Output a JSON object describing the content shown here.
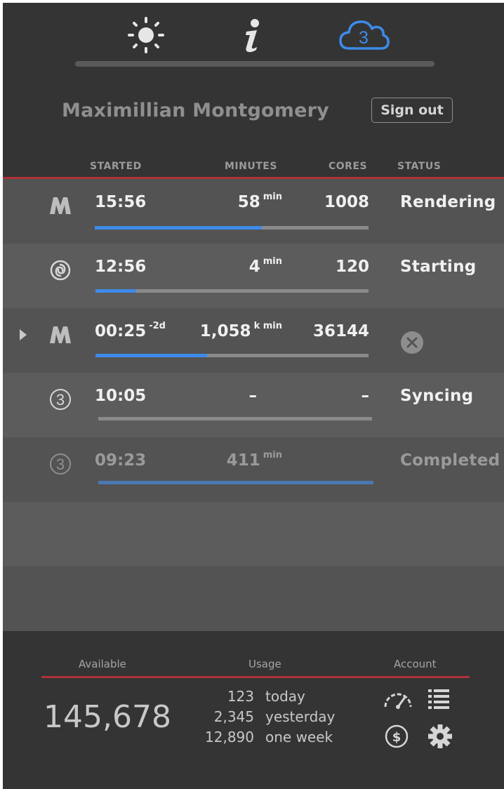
{
  "tabs": [
    {
      "name": "weather",
      "icon": "sun-icon",
      "active": false
    },
    {
      "name": "info",
      "icon": "info-icon",
      "active": false
    },
    {
      "name": "cloud",
      "icon": "cloud-3-icon",
      "active": true,
      "badge": "3"
    }
  ],
  "user": {
    "name": "Maximillian Montgomery",
    "sign_out_label": "Sign out"
  },
  "columns": {
    "started": "STARTED",
    "minutes": "MINUTES",
    "cores": "CORES",
    "status": "STATUS"
  },
  "jobs": [
    {
      "icon": "m-logo-icon",
      "started": "15:56",
      "started_suffix": "",
      "minutes": "58",
      "minutes_unit": "min",
      "cores": "1008",
      "status": "Rendering",
      "progress": 0.61
    },
    {
      "icon": "swirl-icon",
      "started": "12:56",
      "started_suffix": "",
      "minutes": "4",
      "minutes_unit": "min",
      "cores": "120",
      "status": "Starting",
      "progress": 0.15
    },
    {
      "icon": "m-logo-icon",
      "started": "00:25",
      "started_suffix": "-2d",
      "minutes": "1,058",
      "minutes_unit": "k min",
      "cores": "36144",
      "status": "",
      "status_icon": "cancel-circle-icon",
      "progress": 0.41,
      "expandable": true
    },
    {
      "icon": "circled-3-icon",
      "started": "10:05",
      "started_suffix": "",
      "minutes": "–",
      "minutes_unit": "",
      "cores": "–",
      "status": "Syncing",
      "progress": 0.0
    },
    {
      "icon": "circled-3-icon",
      "started": "09:23",
      "started_suffix": "",
      "minutes": "411",
      "minutes_unit": "min",
      "cores": "",
      "status": "Completed",
      "progress": 1.0,
      "faded": true
    }
  ],
  "footer": {
    "available_label": "Available",
    "usage_label": "Usage",
    "account_label": "Account",
    "available_value": "145,678",
    "usage": [
      {
        "value": "123",
        "label": "today"
      },
      {
        "value": "2,345",
        "label": "yesterday"
      },
      {
        "value": "12,890",
        "label": "one week"
      }
    ],
    "account_icons": [
      "speedometer-icon",
      "list-icon",
      "dollar-circle-icon",
      "gear-icon"
    ]
  },
  "colors": {
    "accent": "#3d8bea",
    "red_line": "#b0303a",
    "background": "#343434"
  }
}
